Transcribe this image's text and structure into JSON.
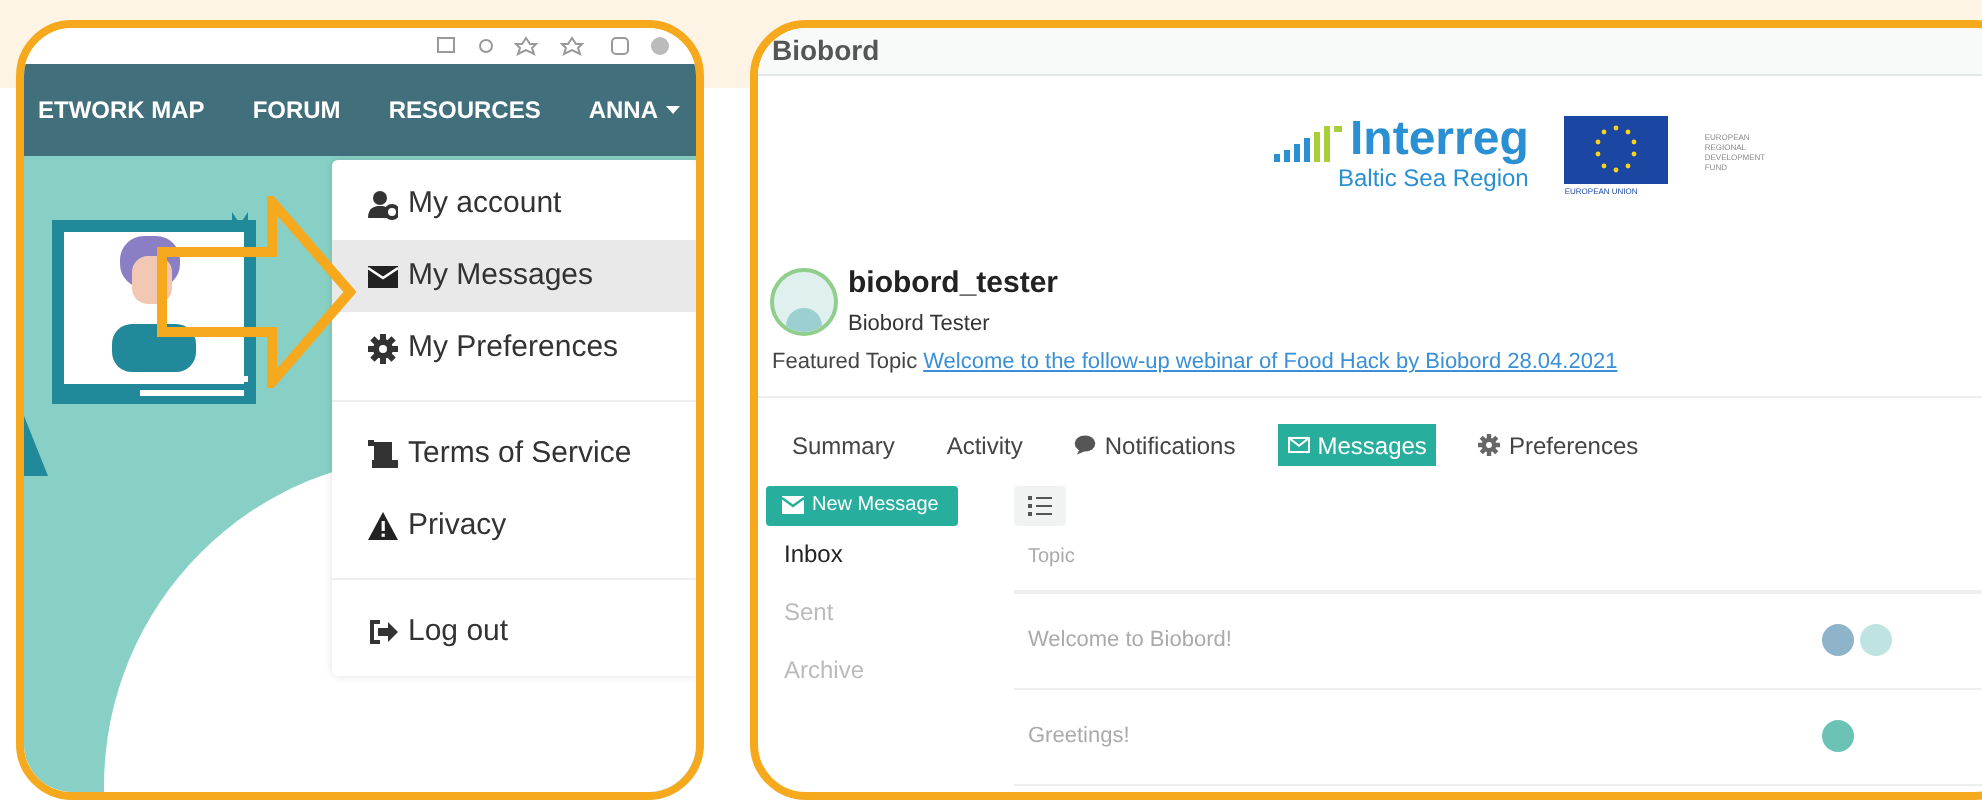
{
  "left_panel": {
    "nav": [
      {
        "label": "ETWORK MAP",
        "dropdown": false
      },
      {
        "label": "FORUM",
        "dropdown": false
      },
      {
        "label": "RESOURCES",
        "dropdown": false
      },
      {
        "label": "ANNA",
        "dropdown": true
      }
    ],
    "menu_groups": [
      [
        {
          "kind": "account",
          "label": "My account",
          "selected": false
        },
        {
          "kind": "messages",
          "label": "My Messages",
          "selected": true
        },
        {
          "kind": "preferences",
          "label": "My Preferences",
          "selected": false
        }
      ],
      [
        {
          "kind": "terms",
          "label": "Terms of Service",
          "selected": false
        },
        {
          "kind": "privacy",
          "label": "Privacy",
          "selected": false
        }
      ],
      [
        {
          "kind": "logout",
          "label": "Log out",
          "selected": false
        }
      ]
    ]
  },
  "right_panel": {
    "title": "Biobord",
    "interreg_logo": {
      "name": "Interreg",
      "region": "Baltic Sea Region"
    },
    "eu_logo": {
      "caption": "EUROPEAN UNION",
      "fund_lines": [
        "EUROPEAN",
        "REGIONAL",
        "DEVELOPMENT",
        "FUND"
      ]
    },
    "profile": {
      "username": "biobord_tester",
      "full_name": "Biobord Tester",
      "featured_label": "Featured Topic",
      "featured_link": "Welcome to the follow-up webinar of Food Hack by Biobord 28.04.2021"
    },
    "tabs": [
      {
        "kind": "plain",
        "label": "Summary",
        "selected": false
      },
      {
        "kind": "plain",
        "label": "Activity",
        "selected": false
      },
      {
        "kind": "notifications",
        "label": "Notifications",
        "selected": false
      },
      {
        "kind": "messages",
        "label": "Messages",
        "selected": true
      },
      {
        "kind": "preferences",
        "label": "Preferences",
        "selected": false
      }
    ],
    "new_message_button": "New Message",
    "folders": [
      {
        "label": "Inbox",
        "selected": true
      },
      {
        "label": "Sent",
        "selected": false
      },
      {
        "label": "Archive",
        "selected": false
      }
    ],
    "table": {
      "columns": [
        "Topic"
      ],
      "rows": [
        {
          "topic": "Welcome to Biobord!",
          "avatars": [
            {
              "color": "#8fb3c9"
            },
            {
              "color": "#bfe3e0"
            }
          ]
        },
        {
          "topic": "Greetings!",
          "avatars": [
            {
              "color": "#6cc2b4"
            }
          ]
        }
      ]
    }
  }
}
